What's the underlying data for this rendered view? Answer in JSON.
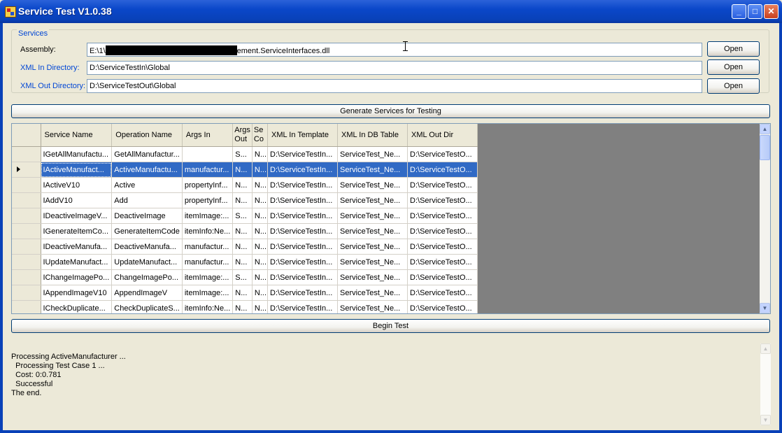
{
  "window": {
    "title": "Service Test V1.0.38",
    "minimize": "_",
    "maximize": "□",
    "close": "✕"
  },
  "services": {
    "group_label": "Services",
    "assembly_label": "Assembly:",
    "assembly_value_prefix": "E:\\1\\",
    "assembly_value_suffix": "ement.ServiceInterfaces.dll",
    "xml_in_label": "XML In Directory:",
    "xml_in_value": "D:\\ServiceTestIn\\Global",
    "xml_out_label": "XML Out Directory:",
    "xml_out_value": "D:\\ServiceTestOut\\Global",
    "open_label": "Open"
  },
  "generate_label": "Generate Services for Testing",
  "begin_label": "Begin Test",
  "grid": {
    "columns": [
      "Service Name",
      "Operation Name",
      "Args In",
      "Args Out",
      "Se Co",
      "XML In Template",
      "XML In DB Table",
      "XML Out Dir"
    ],
    "rows": [
      [
        "IGetAllManufactu...",
        "GetAllManufactur...",
        "",
        "S...",
        "N...",
        "D:\\ServiceTestIn...",
        "ServiceTest_Ne...",
        "D:\\ServiceTestO..."
      ],
      [
        "IActiveManufact...",
        "ActiveManufactu...",
        "manufactur...",
        "N...",
        "N...",
        "D:\\ServiceTestIn...",
        "ServiceTest_Ne...",
        "D:\\ServiceTestO..."
      ],
      [
        "IActiveV10",
        "Active",
        "propertyInf...",
        "N...",
        "N...",
        "D:\\ServiceTestIn...",
        "ServiceTest_Ne...",
        "D:\\ServiceTestO..."
      ],
      [
        "IAddV10",
        "Add",
        "propertyInf...",
        "N...",
        "N...",
        "D:\\ServiceTestIn...",
        "ServiceTest_Ne...",
        "D:\\ServiceTestO..."
      ],
      [
        "IDeactiveImageV...",
        "DeactiveImage",
        "itemImage:...",
        "S...",
        "N...",
        "D:\\ServiceTestIn...",
        "ServiceTest_Ne...",
        "D:\\ServiceTestO..."
      ],
      [
        "IGenerateItemCo...",
        "GenerateItemCode",
        "itemInfo:Ne...",
        "N...",
        "N...",
        "D:\\ServiceTestIn...",
        "ServiceTest_Ne...",
        "D:\\ServiceTestO..."
      ],
      [
        "IDeactiveManufa...",
        "DeactiveManufa...",
        "manufactur...",
        "N...",
        "N...",
        "D:\\ServiceTestIn...",
        "ServiceTest_Ne...",
        "D:\\ServiceTestO..."
      ],
      [
        "IUpdateManufact...",
        "UpdateManufact...",
        "manufactur...",
        "N...",
        "N...",
        "D:\\ServiceTestIn...",
        "ServiceTest_Ne...",
        "D:\\ServiceTestO..."
      ],
      [
        "IChangeImagePo...",
        "ChangeImagePo...",
        "itemImage:...",
        "S...",
        "N...",
        "D:\\ServiceTestIn...",
        "ServiceTest_Ne...",
        "D:\\ServiceTestO..."
      ],
      [
        "IAppendImageV10",
        "AppendImageV",
        "itemImage:...",
        "N...",
        "N...",
        "D:\\ServiceTestIn...",
        "ServiceTest_Ne...",
        "D:\\ServiceTestO..."
      ],
      [
        "ICheckDuplicate...",
        "CheckDuplicateS...",
        "itemInfo:Ne...",
        "N...",
        "N...",
        "D:\\ServiceTestIn...",
        "ServiceTest_Ne...",
        "D:\\ServiceTestO..."
      ]
    ],
    "selected_row": 1
  },
  "log": [
    "Processing ActiveManufacturer ...",
    "  Processing Test Case 1 ...",
    "  Cost: 0:0.781",
    "  Successful",
    "The end."
  ]
}
